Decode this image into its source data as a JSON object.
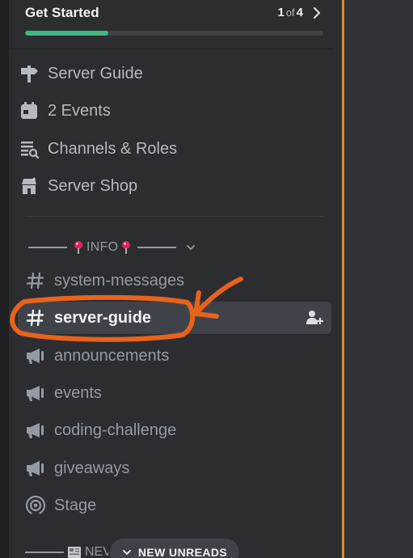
{
  "get_started": {
    "title": "Get Started",
    "step_current": "1",
    "step_of": "of",
    "step_total": "4",
    "progress": 0.28
  },
  "server_nav": [
    {
      "label": "Server Guide",
      "icon": "signpost-icon"
    },
    {
      "label": "2 Events",
      "icon": "calendar-icon"
    },
    {
      "label": "Channels & Roles",
      "icon": "channels-roles-icon"
    },
    {
      "label": "Server Shop",
      "icon": "shop-icon"
    }
  ],
  "category": {
    "label": "INFO"
  },
  "channels": [
    {
      "label": "system-messages",
      "icon": "hash-icon"
    },
    {
      "label": "server-guide",
      "icon": "hash-icon",
      "selected": true
    },
    {
      "label": "announcements",
      "icon": "megaphone-icon"
    },
    {
      "label": "events",
      "icon": "megaphone-icon"
    },
    {
      "label": "coding-challenge",
      "icon": "megaphone-icon"
    },
    {
      "label": "giveaways",
      "icon": "megaphone-icon"
    },
    {
      "label": "Stage",
      "icon": "stage-icon"
    }
  ],
  "bottom_category": {
    "label": "NEV"
  },
  "new_unreads": {
    "label": "NEW UNREADS"
  },
  "colors": {
    "sidebar_bg": "#2b2d31",
    "selected_bg": "#404249",
    "progress_green": "#43b581",
    "annotation_orange": "#e8631c",
    "pin_red": "#e0245e"
  }
}
